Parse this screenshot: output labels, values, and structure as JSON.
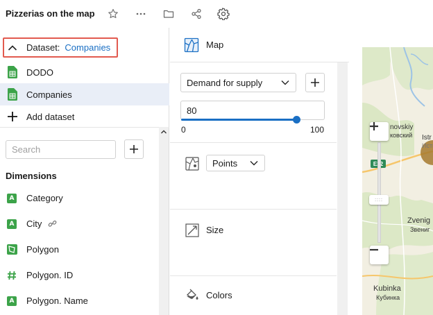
{
  "header": {
    "title": "Pizzerias on the map",
    "icons": [
      "star-icon",
      "more-icon",
      "folder-icon",
      "share-icon",
      "gear-icon"
    ]
  },
  "dataset_panel": {
    "toggle_label": "Dataset:",
    "toggle_value": "Companies",
    "datasets": [
      {
        "label": "DODO",
        "icon": "spreadsheet-icon",
        "selected": false
      },
      {
        "label": "Companies",
        "icon": "spreadsheet-icon",
        "selected": true
      }
    ],
    "add_dataset_label": "Add dataset",
    "search_placeholder": "Search",
    "dimensions_title": "Dimensions",
    "fields": [
      {
        "label": "Category",
        "icon": "string-type-icon"
      },
      {
        "label": "City",
        "icon": "string-type-icon",
        "has_link": true
      },
      {
        "label": "Polygon",
        "icon": "polygon-type-icon"
      },
      {
        "label": "Polygon. ID",
        "icon": "number-type-icon"
      },
      {
        "label": "Polygon. Name",
        "icon": "string-type-icon"
      }
    ]
  },
  "visualization_panel": {
    "type_label": "Map",
    "layer_select": "Demand for supply",
    "opacity_value": "80",
    "slider": {
      "value": 80,
      "min_label": "0",
      "max_label": "100"
    },
    "geometry_select": "Points",
    "sections": [
      "Size",
      "Colors"
    ]
  },
  "map": {
    "labels": {
      "place1": "novskiy",
      "place1_ru": "ковский",
      "road": "E22",
      "place2": "Istr",
      "place2_ru": "Исти",
      "place3": "Zvenig",
      "place3_ru": "Звениг",
      "place4": "Kubinka",
      "place4_ru": "Кубинка"
    }
  },
  "colors": {
    "accent": "#1a6fc4",
    "highlight_border": "#e25a4f",
    "selected_row": "#e9eef7",
    "type_badge": "#3ca349",
    "map_point": "#a6792d"
  }
}
